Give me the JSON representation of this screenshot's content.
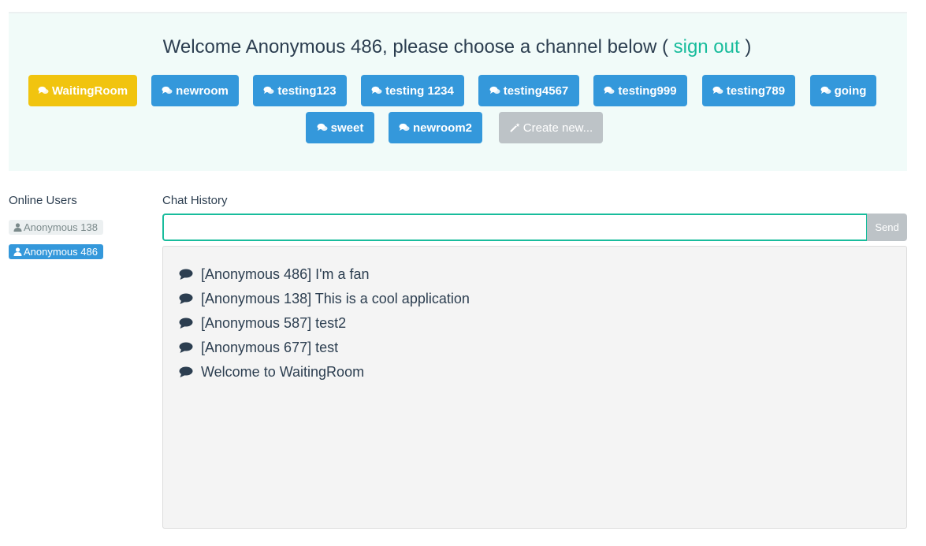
{
  "header": {
    "welcome_prefix": "Welcome Anonymous 486, please choose a channel below ( ",
    "sign_out": "sign out",
    "welcome_suffix": " )"
  },
  "channels": [
    {
      "label": "WaitingRoom",
      "active": true
    },
    {
      "label": "newroom"
    },
    {
      "label": "testing123"
    },
    {
      "label": "testing 1234"
    },
    {
      "label": "testing4567"
    },
    {
      "label": "testing999"
    },
    {
      "label": "testing789"
    },
    {
      "label": "going"
    },
    {
      "label": "sweet"
    },
    {
      "label": "newroom2"
    }
  ],
  "create_new": "Create new...",
  "online_users": {
    "title": "Online Users",
    "users": [
      "Anonymous 138",
      "Anonymous 486"
    ]
  },
  "chat": {
    "title": "Chat History",
    "input_value": "",
    "send_label": "Send",
    "messages": [
      "[Anonymous 486] I'm a fan",
      "[Anonymous 138] This is a cool application",
      "[Anonymous 587] test2",
      "[Anonymous 677] test",
      "Welcome to WaitingRoom"
    ]
  },
  "colors": {
    "primary": "#3498db",
    "active": "#f1c40f",
    "accent": "#18bc9c",
    "disabled": "#bdc3c7",
    "text": "#2c3e50"
  }
}
